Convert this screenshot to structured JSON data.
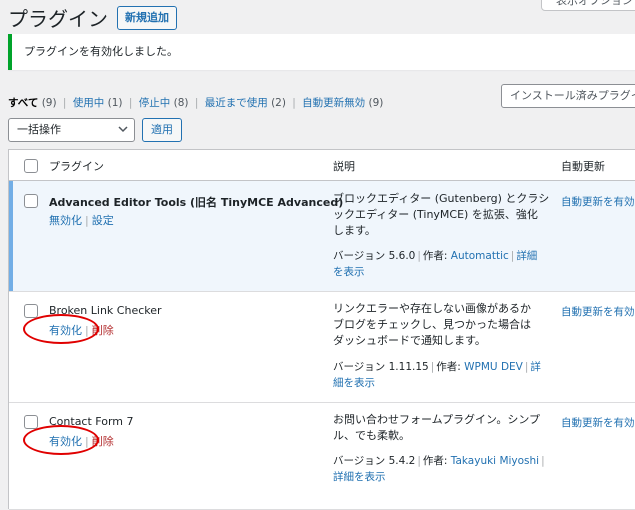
{
  "header": {
    "title": "プラグイン",
    "add_new_label": "新規追加",
    "screen_options_label": "表示オプション"
  },
  "notice": {
    "message": "プラグインを有効化しました。"
  },
  "filters": [
    {
      "label": "すべて",
      "count": "(9)"
    },
    {
      "label": "使用中",
      "count": "(1)"
    },
    {
      "label": "停止中",
      "count": "(8)"
    },
    {
      "label": "最近まで使用",
      "count": "(2)"
    },
    {
      "label": "自動更新無効",
      "count": "(9)"
    }
  ],
  "search": {
    "placeholder": "インストール済みプラグインを検索..."
  },
  "bulk": {
    "selected": "一括操作",
    "apply_label": "適用"
  },
  "table": {
    "columns": {
      "plugin": "プラグイン",
      "description": "説明",
      "auto_update": "自動更新"
    },
    "rows": [
      {
        "name": "Advanced Editor Tools (旧名 TinyMCE Advanced)",
        "action1": "無効化",
        "action2": "設定",
        "desc_lines": [
          "ブロックエディター (Gutenberg) とクラシ",
          "ックエディター (TinyMCE) を拡張、強化",
          "します。"
        ],
        "version": "バージョン 5.6.0",
        "author_label": "作者:",
        "author": "Automattic",
        "details_1": "詳細",
        "details_2": "を表示",
        "auto_update": "自動更新を有効化"
      },
      {
        "name": "Broken Link Checker",
        "action1": "有効化",
        "action2": "削除",
        "desc_lines": [
          "リンクエラーや存在しない画像があるか",
          "ブログをチェックし、見つかった場合は",
          "ダッシュボードで通知します。"
        ],
        "version": "バージョン 1.11.15",
        "author_label": "作者:",
        "author": "WPMU DEV",
        "details_1": "詳",
        "details_2": "細を表示",
        "auto_update": "自動更新を有効化"
      },
      {
        "name": "Contact Form 7",
        "action1": "有効化",
        "action2": "削除",
        "desc_lines": [
          "お問い合わせフォームプラグイン。シンプ",
          "ル、でも柔軟。"
        ],
        "version": "バージョン 5.4.2",
        "author_label": "作者:",
        "author": "Takayuki Miyoshi",
        "details_1": "",
        "details_2": "詳細を表示",
        "auto_update": "自動更新を有効化"
      }
    ]
  },
  "colors": {
    "link": "#2271b1",
    "success": "#00a32a",
    "active_row": "#f0f6fc",
    "active_border": "#72aee6",
    "delete": "#b32d2e",
    "highlight_ellipse": "#e00000"
  }
}
